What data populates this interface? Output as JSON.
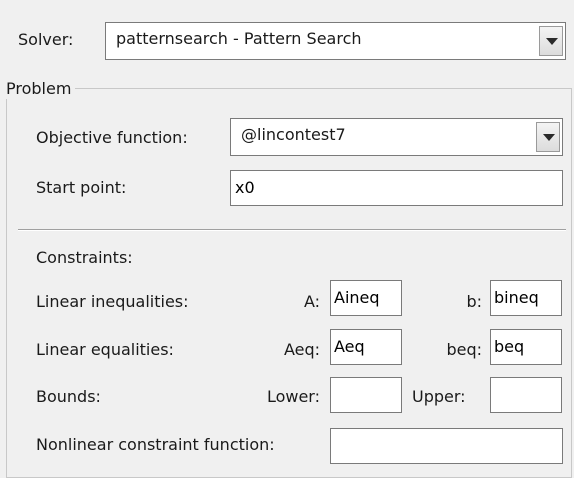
{
  "solver": {
    "label": "Solver:",
    "value": "patternsearch - Pattern Search"
  },
  "problem": {
    "title": "Problem",
    "objective_label": "Objective function:",
    "objective_value": "@lincontest7",
    "start_label": "Start point:",
    "start_value": "x0"
  },
  "constraints": {
    "heading": "Constraints:",
    "linear_ineq": {
      "label": "Linear inequalities:",
      "a_label": "A:",
      "a_value": "Aineq",
      "b_label": "b:",
      "b_value": "bineq"
    },
    "linear_eq": {
      "label": "Linear equalities:",
      "aeq_label": "Aeq:",
      "aeq_value": "Aeq",
      "beq_label": "beq:",
      "beq_value": "beq"
    },
    "bounds": {
      "label": "Bounds:",
      "lower_label": "Lower:",
      "lower_value": "",
      "upper_label": "Upper:",
      "upper_value": ""
    },
    "nonlinear": {
      "label": "Nonlinear constraint function:",
      "value": ""
    }
  },
  "icons": {
    "dropdown": "chevron-down-icon"
  }
}
